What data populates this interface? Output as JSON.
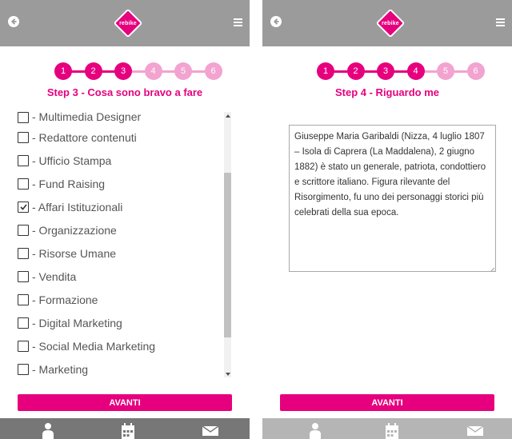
{
  "colors": {
    "accent": "#e6007e",
    "step_done": "#e6007e",
    "step_todo": "#f2a3cf",
    "topbar": "#9b9b9b",
    "bottombar_left": "#777777",
    "bottombar_right": "#b5b5b5"
  },
  "icons": {
    "back": "arrow-left-circle-icon",
    "menu": "hamburger-menu-icon",
    "logo": "diamond-logo",
    "profile": "user-icon",
    "calendar": "calendar-icon",
    "mail": "envelope-icon"
  },
  "logo_text": "rebike",
  "left": {
    "current_step": 3,
    "steps": [
      "1",
      "2",
      "3",
      "4",
      "5",
      "6"
    ],
    "title": "Step 3 - Cosa sono bravo a fare",
    "options": [
      {
        "label": "- Multimedia Designer",
        "checked": false
      },
      {
        "label": "- Redattore contenuti",
        "checked": false
      },
      {
        "label": "- Ufficio Stampa",
        "checked": false
      },
      {
        "label": "- Fund Raising",
        "checked": false
      },
      {
        "label": "- Affari Istituzionali",
        "checked": true
      },
      {
        "label": "- Organizzazione",
        "checked": false
      },
      {
        "label": "- Risorse Umane",
        "checked": false
      },
      {
        "label": "- Vendita",
        "checked": false
      },
      {
        "label": "- Formazione",
        "checked": false
      },
      {
        "label": "- Digital Marketing",
        "checked": false
      },
      {
        "label": "- Social Media Marketing",
        "checked": false
      },
      {
        "label": "- Marketing",
        "checked": false
      }
    ],
    "scroll_position_fraction": 0.62,
    "button_label": "AVANTI"
  },
  "right": {
    "current_step": 4,
    "steps": [
      "1",
      "2",
      "3",
      "4",
      "5",
      "6"
    ],
    "title": "Step 4 - Riguardo me",
    "textarea_value": "Giuseppe Maria Garibaldi (Nizza, 4 luglio 1807 – Isola di Caprera (La Maddalena), 2 giugno 1882) è stato un generale, patriota, condottiero e scrittore italiano. Figura rilevante del Risorgimento, fu uno dei personaggi storici più celebrati della sua epoca.",
    "button_label": "AVANTI"
  }
}
